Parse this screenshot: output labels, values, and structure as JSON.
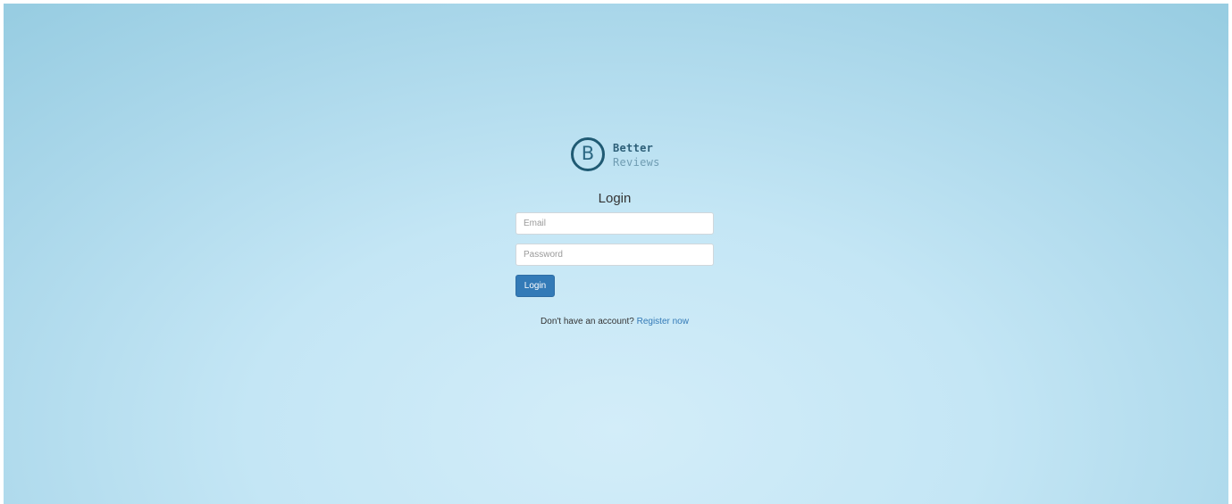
{
  "logo": {
    "letter": "B",
    "line1": "Better",
    "line2": "Reviews"
  },
  "form": {
    "title": "Login",
    "email_placeholder": "Email",
    "email_value": "",
    "password_placeholder": "Password",
    "password_value": "",
    "submit_label": "Login"
  },
  "register": {
    "prompt": "Don't have an account?",
    "link_label": "Register now"
  },
  "colors": {
    "accent": "#337ab7",
    "logo_dark": "#1f5a73",
    "logo_light": "#6f9cb2",
    "background_center": "#d3edf9",
    "background_edge": "#98cde2"
  }
}
